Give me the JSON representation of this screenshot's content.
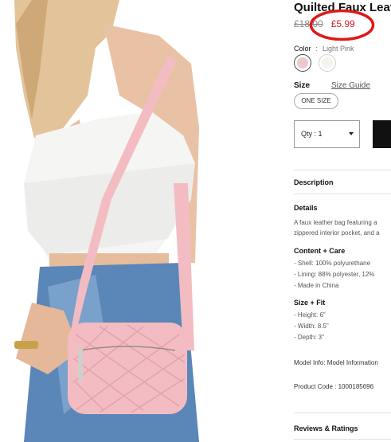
{
  "product": {
    "title": "Quilted Faux Leat",
    "old_price": "£18.00",
    "new_price": "£5.99"
  },
  "color": {
    "label": "Color",
    "separator": ":",
    "value": "Light Pink",
    "swatches": [
      "#ecc9cb",
      "#f6f4ee"
    ]
  },
  "size": {
    "label": "Size",
    "guide": "Size Guide",
    "option": "ONE SIZE"
  },
  "quantity": {
    "label": "Qty : 1"
  },
  "sections": {
    "description": "Description",
    "details": "Details",
    "details_lines": [
      "A faux leather bag featuring a",
      "zippered interior pocket, and a"
    ],
    "content_care": "Content + Care",
    "content_lines": [
      "- Shell: 100% polyurethane",
      "- Lining: 88% polyester, 12%",
      "- Made in China"
    ],
    "size_fit": "Size + Fit",
    "fit_lines": [
      "- Height: 6\"",
      "- Width: 8.5\"",
      "- Depth: 3\""
    ],
    "model_info": "Model Info: Model Information",
    "product_code": "Product Code : 1000185696",
    "reviews": "Reviews & Ratings"
  },
  "colors": {
    "sale_red": "#d11a2a",
    "annotation_circle": "#e01818",
    "bag_pink": "#f2bcc2"
  }
}
